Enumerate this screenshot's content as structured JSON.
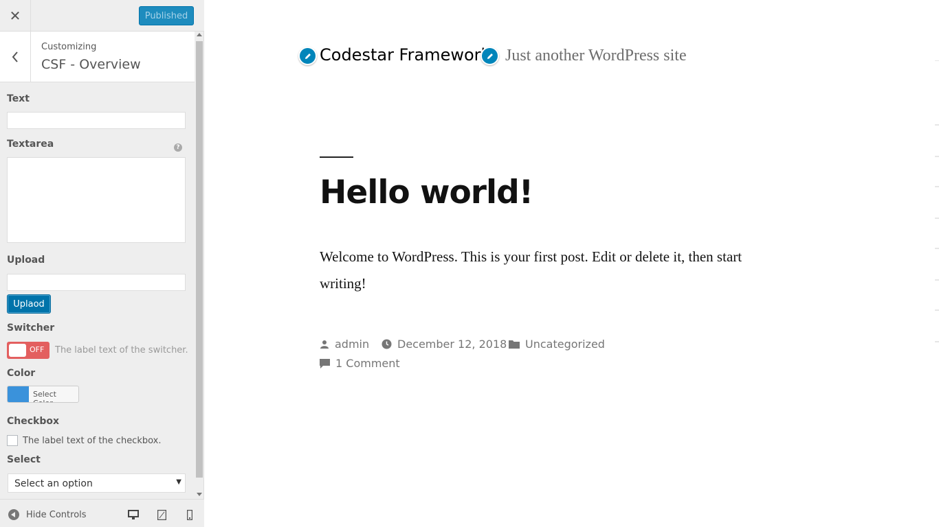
{
  "header": {
    "close_icon": "close-icon",
    "publish_label": "Published"
  },
  "section": {
    "customizing_label": "Customizing",
    "title": "CSF - Overview"
  },
  "controls": {
    "text_label": "Text",
    "text_value": "",
    "textarea_label": "Textarea",
    "textarea_value": "",
    "help_glyph": "?",
    "upload_label": "Upload",
    "upload_value": "",
    "upload_button": "Uplaod",
    "switcher_label": "Switcher",
    "switcher_state": "OFF",
    "switcher_desc": "The label text of the switcher.",
    "color_label": "Color",
    "color_value": "#3a92db",
    "color_button": "Select Color",
    "checkbox_label": "Checkbox",
    "checkbox_text": "The label text of the checkbox.",
    "select_label": "Select",
    "select_value": "Select an option"
  },
  "footer": {
    "hide_controls": "Hide Controls",
    "devices": [
      "desktop-icon",
      "tablet-icon",
      "mobile-icon"
    ]
  },
  "preview": {
    "site_title": "Codestar Framework",
    "tagline": "Just another WordPress site",
    "post_title": "Hello world!",
    "post_body": "Welcome to WordPress. This is your first post. Edit or delete it, then start writing!",
    "author": "admin",
    "date": "December 12, 2018",
    "category": "Uncategorized",
    "comments": "1 Comment"
  },
  "colors": {
    "accent": "#0073aa",
    "switch_off": "#e35f5f",
    "edit_shortcut": "#0085ba"
  }
}
